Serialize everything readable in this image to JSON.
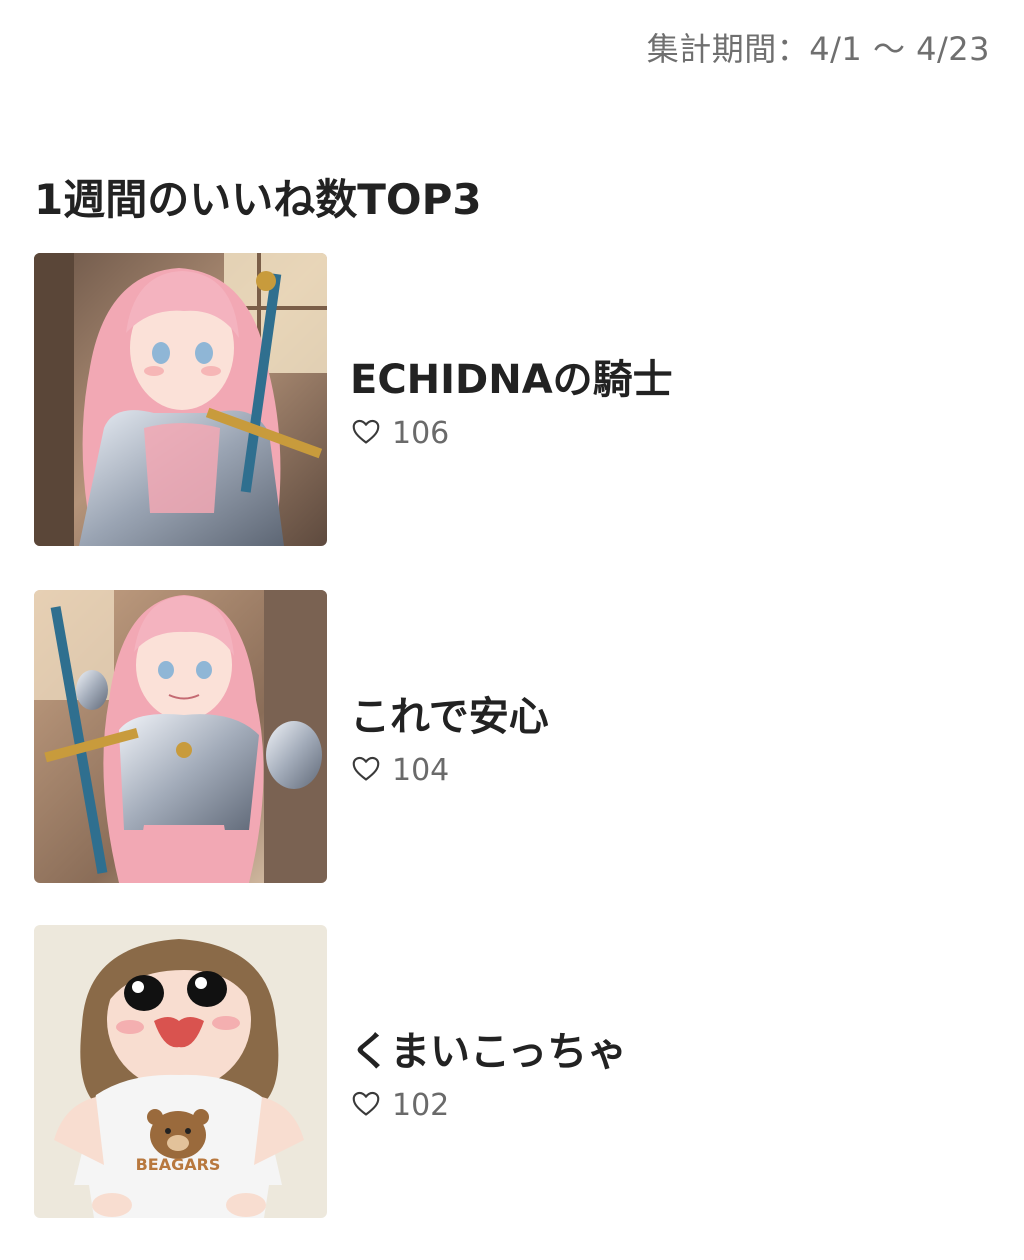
{
  "header": {
    "period_label": "集計期間：4/1 〜 4/23"
  },
  "ranking": {
    "title": "1週間のいいね数TOP3",
    "items": [
      {
        "title": "ECHIDNAの騎士",
        "likes": "106",
        "thumbnail_icon": "knight-girl-illustration"
      },
      {
        "title": "これで安心",
        "likes": "104",
        "thumbnail_icon": "knight-girl-illustration"
      },
      {
        "title": "くまいこっちゃ",
        "likes": "102",
        "thumbnail_icon": "bear-shirt-girl-illustration"
      }
    ],
    "thumbnail_logo_text": "BEAGARS"
  },
  "colors": {
    "text": "#222222",
    "muted": "#6f6f6f",
    "hair_pink": "#f2a8b4",
    "armor": "#b8c0cc",
    "hair_brown": "#8a6a48"
  }
}
